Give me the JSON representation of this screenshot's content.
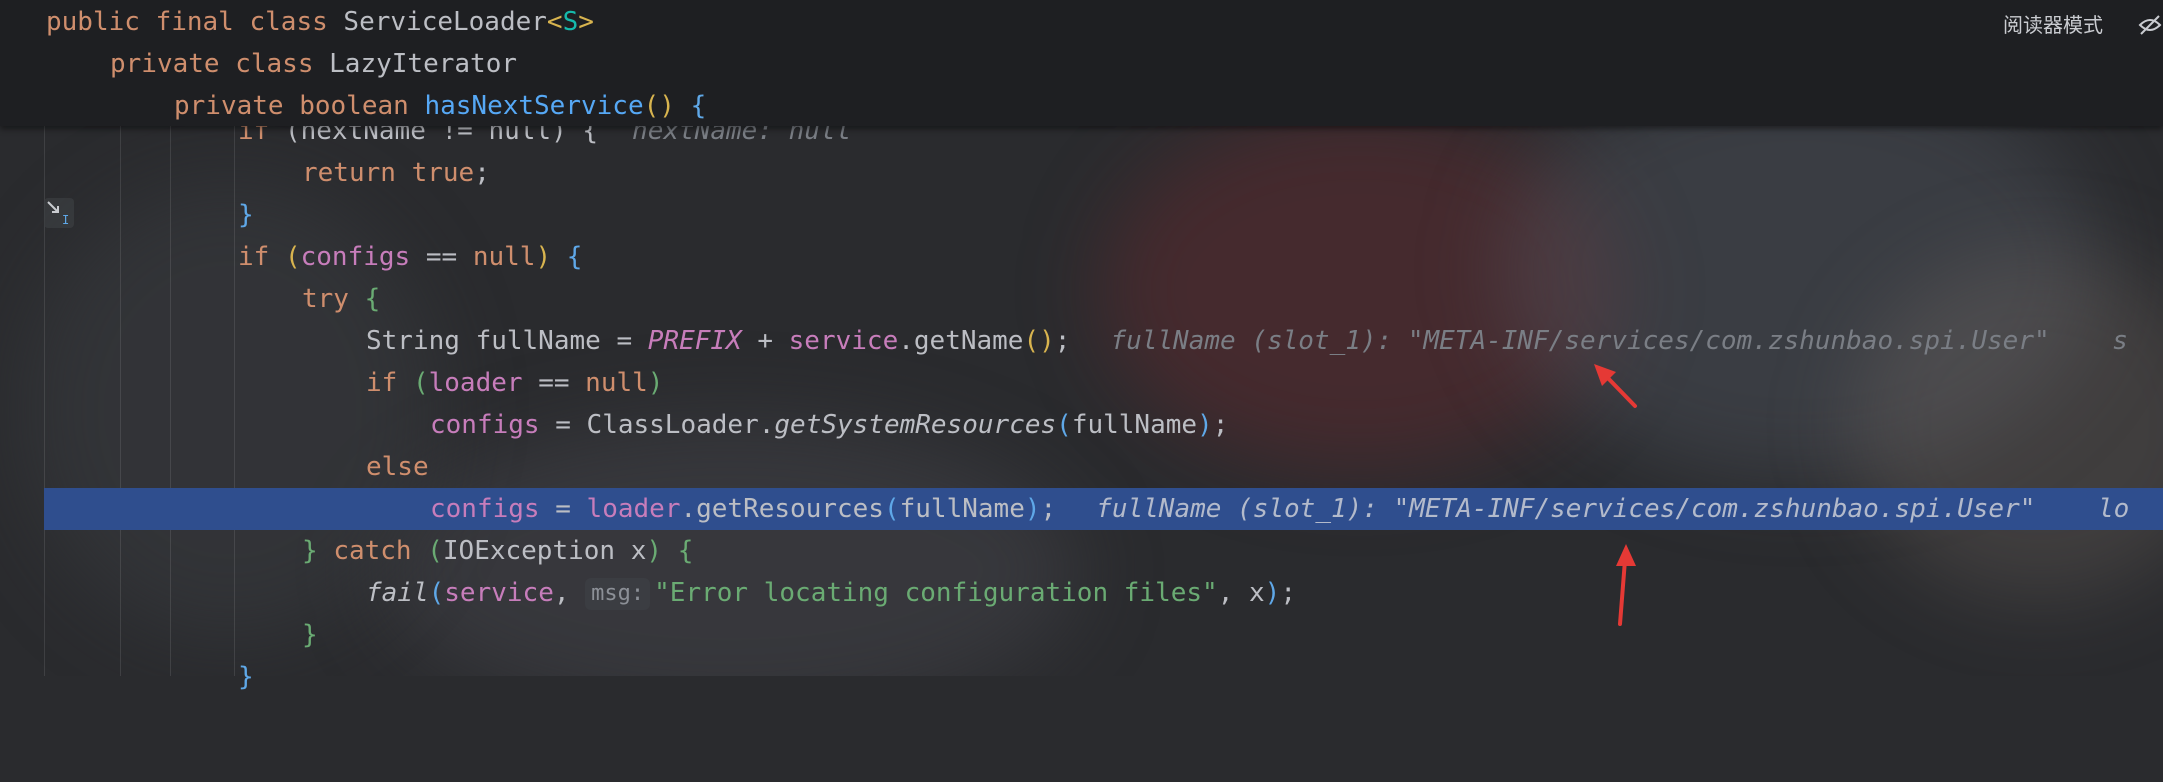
{
  "header": {
    "reader_mode_label": "阅读器模式",
    "scope_lines": [
      {
        "kw": "public final class ",
        "name": "ServiceLoader",
        "lt": "<",
        "tparam": "S",
        "gt": ">"
      },
      {
        "kw": "private class ",
        "name": "LazyIterator"
      },
      {
        "kw": "private boolean ",
        "method": "hasNextService",
        "parens": "()",
        "brace": " {"
      }
    ]
  },
  "code": {
    "l0_kw": "if",
    "l0_text": " (nextName != null) {",
    "l0_hint": "nextName: null",
    "l1_kw": "return ",
    "l1_val": "true",
    "l1_semi": ";",
    "l2_brace": "}",
    "l3_kw": "if ",
    "l3_open": "(",
    "l3_field": "configs",
    "l3_eq": " == ",
    "l3_null": "null",
    "l3_close": ")",
    "l3_brace": " {",
    "l4_kw": "try ",
    "l4_brace": "{",
    "l5_a": "String fullName = ",
    "l5_const": "PREFIX",
    "l5_plus": " + ",
    "l5_field": "service",
    "l5_call": ".getName",
    "l5_parens": "()",
    "l5_semi": ";",
    "l5_hint": "fullName (slot_1): \"META-INF/services/com.zshunbao.spi.User\"    s",
    "l6_kw": "if ",
    "l6_open": "(",
    "l6_field": "loader",
    "l6_eq": " == ",
    "l6_null": "null",
    "l6_close": ")",
    "l7_field": "configs",
    "l7_eq": " = ClassLoader.",
    "l7_call": "getSystemResources",
    "l7_open": "(",
    "l7_arg": "fullName",
    "l7_close": ")",
    "l7_semi": ";",
    "l8_kw": "else",
    "l9_field": "configs",
    "l9_eq": " = ",
    "l9_field2": "loader",
    "l9_call": ".getResources",
    "l9_open": "(",
    "l9_arg": "fullName",
    "l9_close": ")",
    "l9_semi": ";",
    "l9_hint": "fullName (slot_1): \"META-INF/services/com.zshunbao.spi.User\"    lo",
    "l10_brace": "} ",
    "l10_kw": "catch ",
    "l10_open": "(",
    "l10_arg": "IOException x",
    "l10_close": ")",
    "l10_brace2": " {",
    "l11_call": "fail",
    "l11_open": "(",
    "l11_field": "service",
    "l11_comma": ", ",
    "l11_param": "msg:",
    "l11_str": "\"Error locating configuration files\"",
    "l11_rest": ", x",
    "l11_close": ")",
    "l11_semi": ";",
    "l12_brace": "}",
    "l13_brace": "}"
  },
  "colors": {
    "background": "#2a2b2e",
    "sticky_header": "#1e1f22",
    "selection": "#2f4e8e",
    "annotation_arrow": "#e53935"
  }
}
